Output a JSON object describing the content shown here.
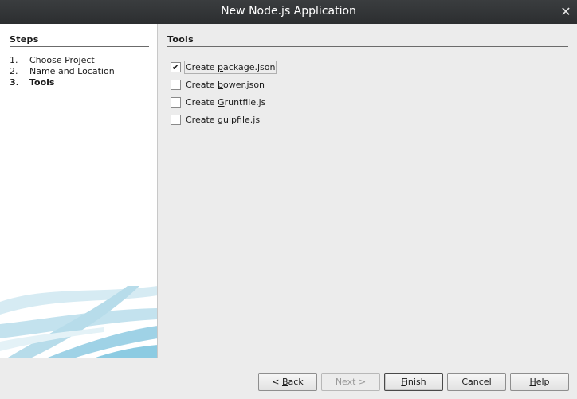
{
  "window": {
    "title": "New Node.js Application",
    "close_glyph": "✕"
  },
  "steps_panel": {
    "heading": "Steps",
    "items": [
      {
        "num": "1.",
        "label": "Choose Project",
        "current": false
      },
      {
        "num": "2.",
        "label": "Name and Location",
        "current": false
      },
      {
        "num": "3.",
        "label": "Tools",
        "current": true
      }
    ]
  },
  "tools_panel": {
    "heading": "Tools",
    "options": [
      {
        "label_pre": "Create ",
        "mnemonic": "p",
        "label_post": "ackage.json",
        "checked": true,
        "focused": true
      },
      {
        "label_pre": "Create ",
        "mnemonic": "b",
        "label_post": "ower.json",
        "checked": false,
        "focused": false
      },
      {
        "label_pre": "Create ",
        "mnemonic": "G",
        "label_post": "runtfile.js",
        "checked": false,
        "focused": false
      },
      {
        "label_pre": "Create ",
        "mnemonic": "g",
        "label_post": "ulpfile.js",
        "checked": false,
        "focused": false
      }
    ],
    "check_glyph": "✔"
  },
  "buttons": {
    "back": {
      "pre": "< ",
      "mnemonic": "B",
      "post": "ack"
    },
    "next": {
      "label": "Next >"
    },
    "finish": {
      "pre": "",
      "mnemonic": "F",
      "post": "inish"
    },
    "cancel": {
      "label": "Cancel"
    },
    "help": {
      "pre": "",
      "mnemonic": "H",
      "post": "elp"
    }
  }
}
